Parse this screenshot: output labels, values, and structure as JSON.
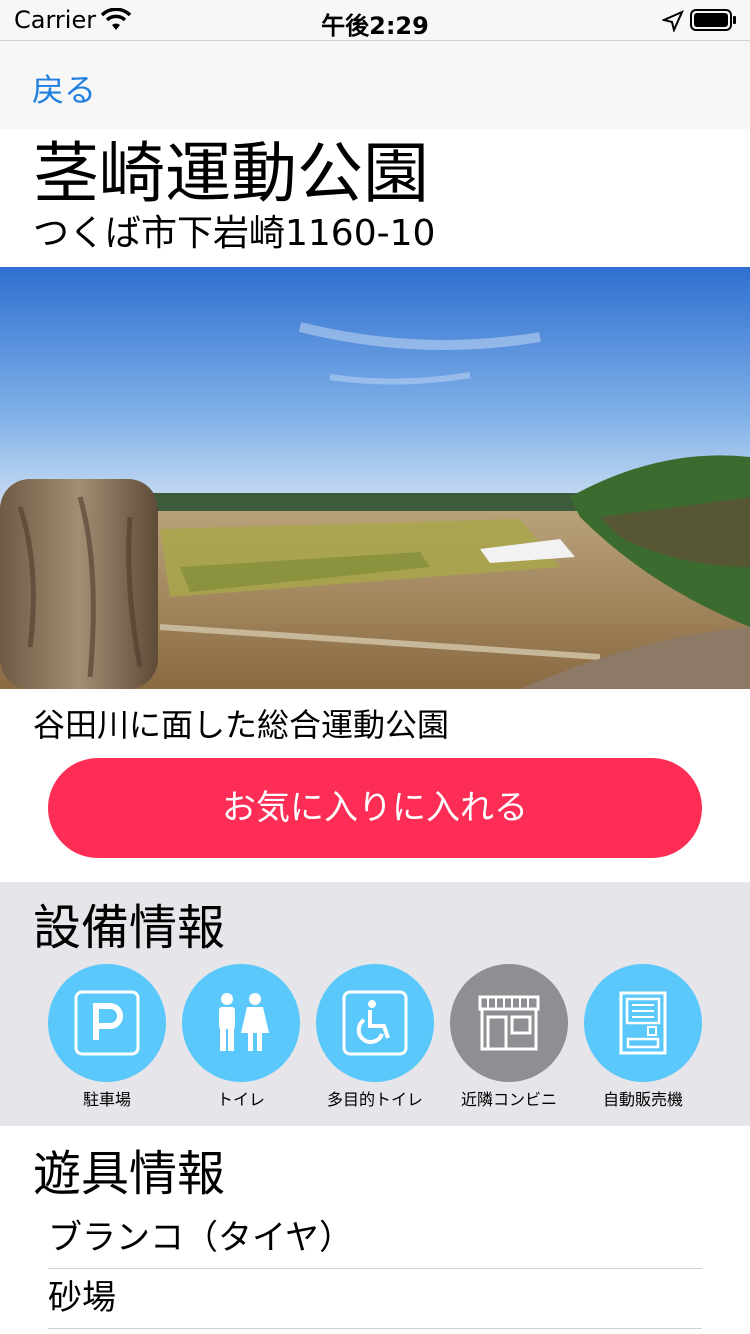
{
  "status": {
    "carrier": "Carrier",
    "time": "午後2:29"
  },
  "nav": {
    "back_label": "戻る"
  },
  "park": {
    "name": "茎崎運動公園",
    "address": "つくば市下岩崎1160-10",
    "description": "谷田川に面した総合運動公園"
  },
  "favorite_button": {
    "label": "お気に入りに入れる",
    "color": "#fe2d55"
  },
  "facilities": {
    "heading": "設備情報",
    "items": [
      {
        "label": "駐車場",
        "icon": "parking-icon",
        "available": true
      },
      {
        "label": "トイレ",
        "icon": "restroom-icon",
        "available": true
      },
      {
        "label": "多目的トイレ",
        "icon": "wheelchair-icon",
        "available": true
      },
      {
        "label": "近隣コンビニ",
        "icon": "store-icon",
        "available": false
      },
      {
        "label": "自動販売機",
        "icon": "vending-machine-icon",
        "available": true
      }
    ]
  },
  "playground": {
    "heading": "遊具情報",
    "items": [
      "ブランコ（タイヤ）",
      "砂場"
    ]
  },
  "colors": {
    "accent_blue": "#1f7fe0",
    "available": "#5ac8fa",
    "unavailable": "#8e8e93",
    "section_bg": "#e5e5ea"
  }
}
